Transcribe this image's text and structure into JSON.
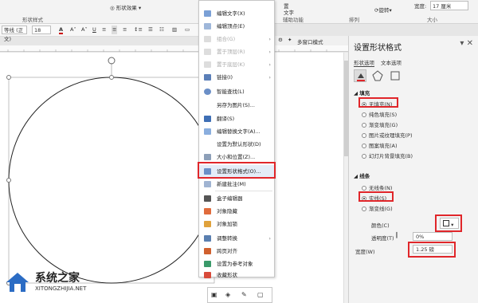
{
  "ribbon": {
    "group_shape_styles": "形状样式",
    "shape_effects": "形状效果",
    "edit_text_vertical": "置",
    "text_label": "文字",
    "assist_function": "辅助功能",
    "arrange": "排列",
    "rotate": "旋转",
    "size": "大小",
    "width_label": "宽度:",
    "width_value": "17 厘米"
  },
  "format_bar": {
    "font_name": "等线 (正文)",
    "font_size": "18",
    "font_color_label": "A",
    "underline": "U"
  },
  "context_menu": {
    "items": [
      {
        "label": "编辑文字(X)",
        "disabled": false,
        "arrow": false
      },
      {
        "label": "编辑顶点(E)",
        "disabled": false,
        "arrow": false
      },
      {
        "label": "组合(G)",
        "disabled": true,
        "arrow": true
      },
      {
        "label": "置于顶层(R)",
        "disabled": true,
        "arrow": true
      },
      {
        "label": "置于底层(K)",
        "disabled": true,
        "arrow": true
      },
      {
        "label": "链接(I)",
        "disabled": false,
        "arrow": true
      },
      {
        "label": "智能查找(L)",
        "disabled": false,
        "arrow": false
      },
      {
        "label": "另存为图片(S)...",
        "disabled": false,
        "arrow": false
      },
      {
        "label": "翻译(S)",
        "disabled": false,
        "arrow": false
      },
      {
        "label": "编辑替换文字(A)...",
        "disabled": false,
        "arrow": false
      },
      {
        "label": "设置为默认形状(D)",
        "disabled": false,
        "arrow": false
      },
      {
        "label": "大小和位置(Z)...",
        "disabled": false,
        "arrow": false
      },
      {
        "label": "设置形状格式(O)...",
        "disabled": false,
        "arrow": false
      },
      {
        "label": "新建批注(M)",
        "disabled": false,
        "arrow": false
      },
      {
        "label": "盒子编辑器",
        "disabled": false,
        "arrow": false
      },
      {
        "label": "对象隐藏",
        "disabled": false,
        "arrow": false
      },
      {
        "label": "对象加锁",
        "disabled": false,
        "arrow": false
      },
      {
        "label": "调整转换",
        "disabled": false,
        "arrow": true
      },
      {
        "label": "跨页对齐",
        "disabled": false,
        "arrow": false
      },
      {
        "label": "设置为参考对象",
        "disabled": false,
        "arrow": false
      },
      {
        "label": "收藏形状",
        "disabled": false,
        "arrow": false
      }
    ]
  },
  "pane": {
    "title": "设置形状格式",
    "tab_shape": "形状选项",
    "tab_text": "文本选项",
    "fill_section": "填充",
    "fill_options": [
      "无填充(N)",
      "纯色填充(S)",
      "渐变填充(G)",
      "图片或纹理填充(P)",
      "图案填充(A)",
      "幻灯片背景填充(B)"
    ],
    "fill_selected": 0,
    "line_section": "线条",
    "line_options": [
      "无线条(N)",
      "实线(S)",
      "渐变线(G)"
    ],
    "line_selected": 1,
    "color_label": "颜色(C)",
    "transparency_label": "透明度(T)",
    "transparency_value": "0%",
    "width_label": "宽度(W)",
    "width_value": "1.25 磅"
  },
  "tabs_bar": {
    "multi_window": "多窗口模式"
  },
  "watermark": {
    "brand": "系统之家",
    "url": "XITONGZHIJIA.NET"
  },
  "colors": {
    "accent_red": "#e0262a",
    "ribbon_bg": "#f3f3f3",
    "pane_bg": "#f3f3f3"
  }
}
